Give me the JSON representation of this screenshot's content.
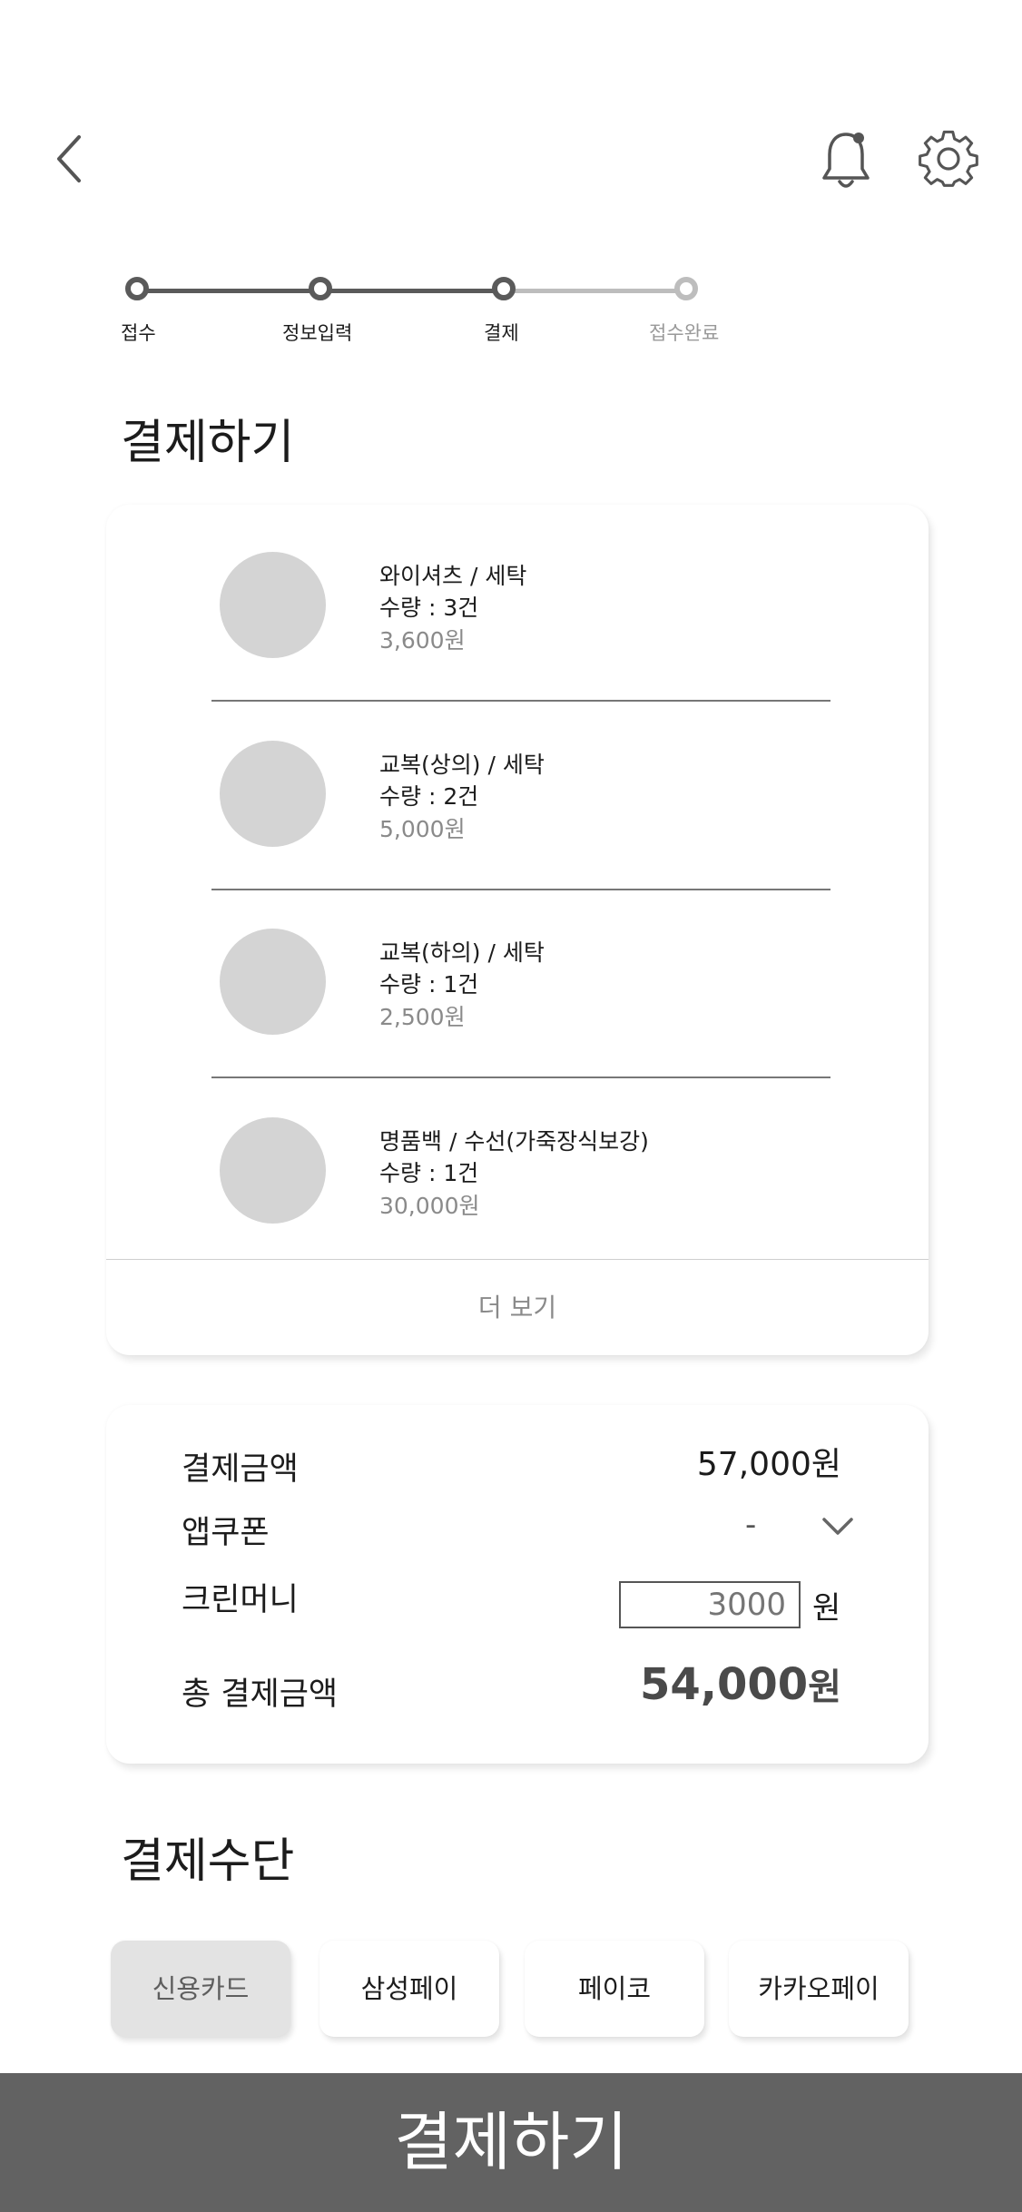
{
  "header": {
    "back_icon": "chevron-left-icon",
    "notification_icon": "bell-icon",
    "settings_icon": "gear-icon"
  },
  "stepper": {
    "steps": [
      {
        "label": "접수",
        "state": "done"
      },
      {
        "label": "정보입력",
        "state": "done"
      },
      {
        "label": "결제",
        "state": "current"
      },
      {
        "label": "접수완료",
        "state": "pending"
      }
    ]
  },
  "order": {
    "title": "결제하기",
    "items": [
      {
        "name": "와이셔츠 / 세탁",
        "quantity": "수량 : 3건",
        "price": "3,600원"
      },
      {
        "name": "교복(상의) / 세탁",
        "quantity": "수량 : 2건",
        "price": "5,000원"
      },
      {
        "name": "교복(하의) / 세탁",
        "quantity": "수량 : 1건",
        "price": "2,500원"
      },
      {
        "name": "명품백 / 수선(가죽장식보강)",
        "quantity": "수량 : 1건",
        "price": "30,000원"
      }
    ],
    "more_label": "더 보기"
  },
  "summary": {
    "amount_label": "결제금액",
    "amount_value": "57,000원",
    "coupon_label": "앱쿠폰",
    "coupon_value": "-",
    "cleanmoney_label": "크린머니",
    "cleanmoney_placeholder": "3000",
    "cleanmoney_unit": "원",
    "total_label": "총 결제금액",
    "total_value": "54,000",
    "total_unit": "원"
  },
  "payment": {
    "title": "결제수단",
    "methods": [
      {
        "label": "신용카드",
        "selected": true
      },
      {
        "label": "삼성페이",
        "selected": false
      },
      {
        "label": "페이코",
        "selected": false
      },
      {
        "label": "카카오페이",
        "selected": false
      }
    ]
  },
  "cta": {
    "label": "결제하기"
  },
  "colors": {
    "primary_dark": "#626262",
    "step_done": "#5a5a5a",
    "step_pending": "#bdbdbd",
    "thumb": "#d4d4d4",
    "muted_text": "#8a8a8a"
  }
}
